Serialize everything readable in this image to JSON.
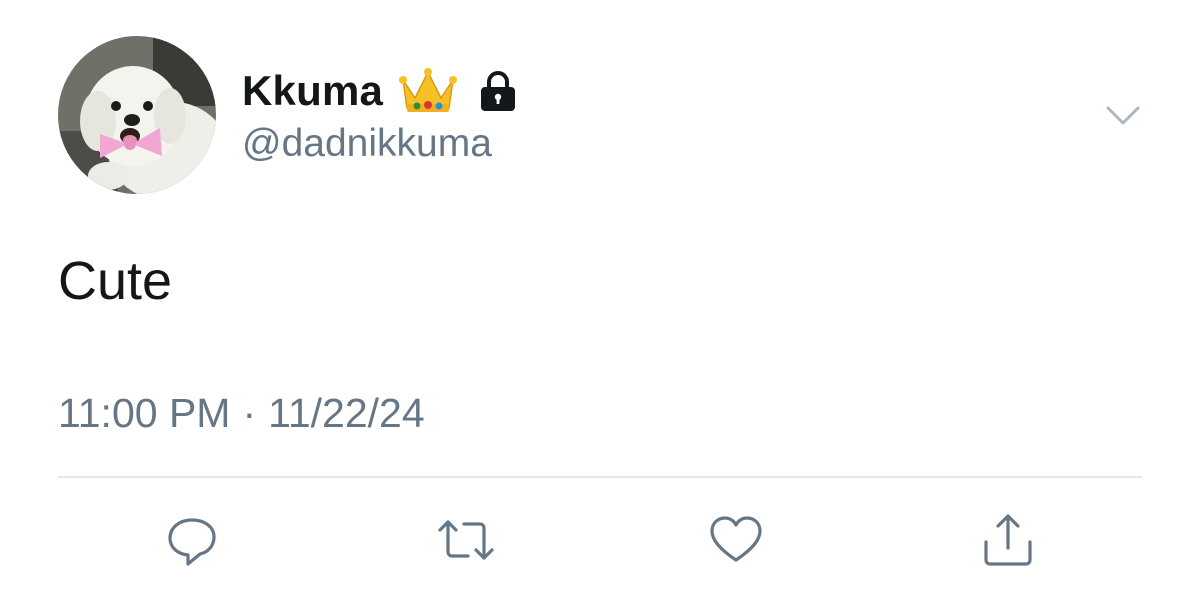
{
  "tweet": {
    "author": {
      "display_name": "Kkuma",
      "handle": "@dadnikkuma",
      "avatar_icon": "avatar-dog-photo",
      "badges": [
        "crown-icon",
        "lock-icon"
      ]
    },
    "text": "Cute",
    "time": "11:00 PM",
    "separator": "·",
    "date": "11/22/24",
    "actions": [
      {
        "name": "reply",
        "icon": "reply-icon"
      },
      {
        "name": "retweet",
        "icon": "retweet-icon"
      },
      {
        "name": "like",
        "icon": "heart-icon"
      },
      {
        "name": "share",
        "icon": "share-icon"
      }
    ],
    "menu_icon": "chevron-down-icon"
  },
  "colors": {
    "text_primary": "#14171a",
    "text_secondary": "#657786",
    "divider": "#e1e8ed",
    "icon": "#657786",
    "background": "#ffffff"
  }
}
